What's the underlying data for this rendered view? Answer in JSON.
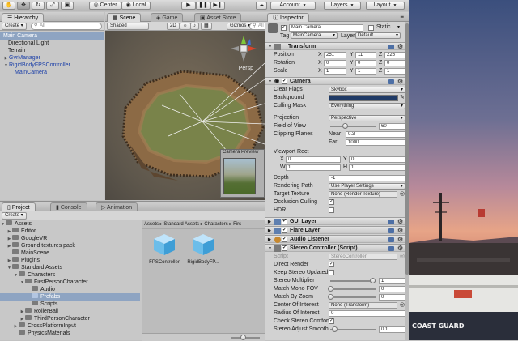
{
  "toolbar": {
    "center_label": "Center",
    "local_label": "Local",
    "account_label": "Account",
    "layers_label": "Layers",
    "layout_label": "Layout"
  },
  "hierarchy": {
    "tab": "Hierarchy",
    "create": "Create",
    "search_placeholder": "All",
    "items": [
      "Main Camera",
      "Directional Light",
      "Terrain",
      "GvrManager",
      "RigidBodyFPSController",
      "MainCamera"
    ]
  },
  "scene": {
    "tabs": [
      "Scene",
      "Game",
      "Asset Store"
    ],
    "shading": "Shaded",
    "mode_2d": "2D",
    "gizmos": "Gizmos",
    "search_placeholder": "All",
    "persp_label": "Persp",
    "camera_preview_label": "Camera Preview"
  },
  "project": {
    "tabs": [
      "Project",
      "Console",
      "Animation"
    ],
    "create": "Create",
    "tree": [
      {
        "label": "Assets",
        "depth": 0,
        "open": true
      },
      {
        "label": "Editor",
        "depth": 1,
        "open": false
      },
      {
        "label": "GoogleVR",
        "depth": 1,
        "open": false
      },
      {
        "label": "Ground textures pack",
        "depth": 1,
        "open": false
      },
      {
        "label": "MainScene",
        "depth": 1,
        "open": false
      },
      {
        "label": "Plugins",
        "depth": 1,
        "open": false
      },
      {
        "label": "Standard Assets",
        "depth": 1,
        "open": true
      },
      {
        "label": "Characters",
        "depth": 2,
        "open": true
      },
      {
        "label": "FirstPersonCharacter",
        "depth": 3,
        "open": true
      },
      {
        "label": "Audio",
        "depth": 4,
        "open": false
      },
      {
        "label": "Prefabs",
        "depth": 4,
        "open": false
      },
      {
        "label": "Scripts",
        "depth": 4,
        "open": false
      },
      {
        "label": "RollerBall",
        "depth": 3,
        "open": false
      },
      {
        "label": "ThirdPersonCharacter",
        "depth": 3,
        "open": false
      },
      {
        "label": "CrossPlatformInput",
        "depth": 2,
        "open": false
      },
      {
        "label": "PhysicsMaterials",
        "depth": 2,
        "open": false
      }
    ],
    "breadcrumb": "Assets ▸ Standard Assets ▸ Characters ▸ Firs",
    "assets": [
      "FPSController",
      "RigidBodyFP..."
    ]
  },
  "inspector": {
    "tab": "Inspector",
    "object_name": "Main Camera",
    "static_label": "Static",
    "tag_label": "Tag",
    "tag_value": "MainCamera",
    "layer_label": "Layer",
    "layer_value": "Default",
    "transform": {
      "title": "Transform",
      "position_label": "Position",
      "position": [
        "251",
        "11",
        "226"
      ],
      "rotation_label": "Rotation",
      "rotation": [
        "0",
        "0",
        "0"
      ],
      "scale_label": "Scale",
      "scale": [
        "1",
        "1",
        "1"
      ]
    },
    "camera": {
      "title": "Camera",
      "clear_flags_label": "Clear Flags",
      "clear_flags": "Skybox",
      "background_label": "Background",
      "culling_mask_label": "Culling Mask",
      "culling_mask": "Everything",
      "projection_label": "Projection",
      "projection": "Perspective",
      "fov_label": "Field of View",
      "fov": "60",
      "fov_fraction": 0.33,
      "clipping_label": "Clipping Planes",
      "near_label": "Near",
      "near": "0.3",
      "far_label": "Far",
      "far": "1000",
      "viewport_label": "Viewport Rect",
      "vx": "0",
      "vy": "0",
      "vw": "1",
      "vh": "1",
      "depth_label": "Depth",
      "depth": "-1",
      "rendering_path_label": "Rendering Path",
      "rendering_path": "Use Player Settings",
      "target_texture_label": "Target Texture",
      "target_texture": "None (Render Texture)",
      "occlusion_label": "Occlusion Culling",
      "hdr_label": "HDR"
    },
    "components": [
      "GUI Layer",
      "Flare Layer",
      "Audio Listener",
      "Stereo Controller (Script)"
    ],
    "stereo": {
      "script_label": "Script",
      "script_value": "StereoController",
      "direct_render_label": "Direct Render",
      "keep_stereo_label": "Keep Stereo Updated",
      "multiplier_label": "Stereo Multiplier",
      "multiplier": "1",
      "match_fov_label": "Match Mono FOV",
      "match_fov": "0",
      "match_zoom_label": "Match By Zoom",
      "match_zoom": "0",
      "center_label": "Center Of Interest",
      "center_value": "None (Transform)",
      "radius_label": "Radius Of Interest",
      "radius": "0",
      "comfort_label": "Check Stereo Comfort",
      "smooth_label": "Stereo Adjust Smooth",
      "smooth": "0.1"
    },
    "axes": [
      "X",
      "Y",
      "Z",
      "W",
      "H"
    ]
  },
  "photo": {
    "ship_text": "COAST GUARD"
  },
  "colors": {
    "selection": "#8ea4c2",
    "blue_prefab_text": "#1b3fa8",
    "camera_background": "#1f3a66"
  }
}
